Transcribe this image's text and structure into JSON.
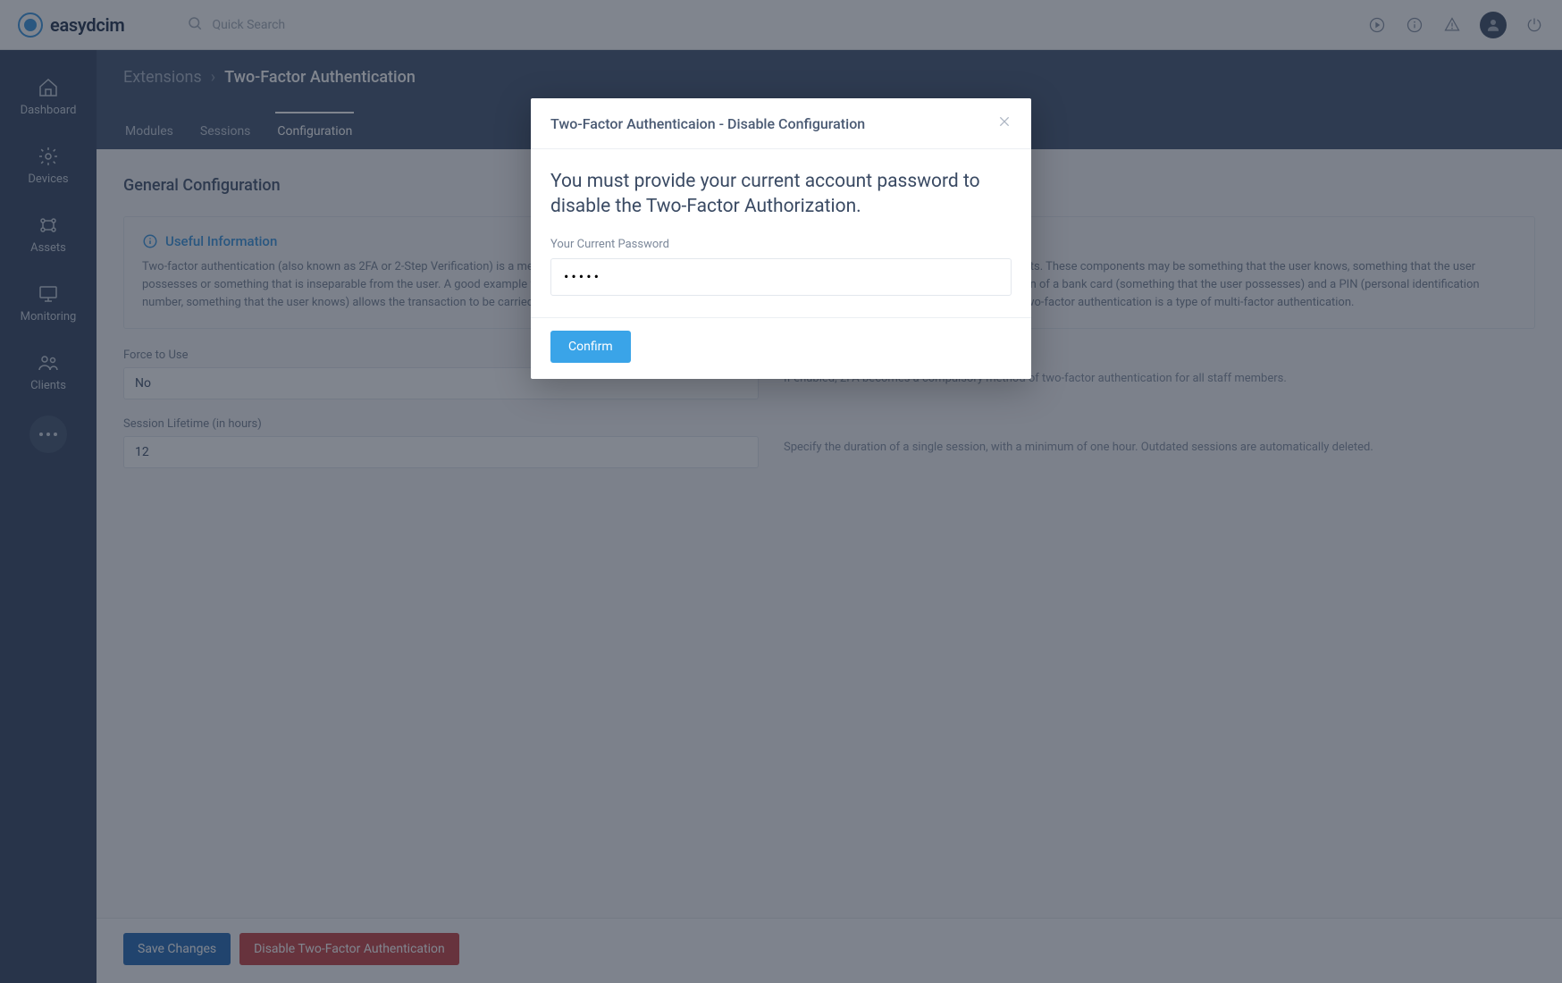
{
  "brand": {
    "name": "easydcim"
  },
  "search": {
    "placeholder": "Quick Search"
  },
  "sidebar": {
    "items": [
      {
        "label": "Dashboard"
      },
      {
        "label": "Devices"
      },
      {
        "label": "Assets"
      },
      {
        "label": "Monitoring"
      },
      {
        "label": "Clients"
      }
    ]
  },
  "breadcrumb": {
    "parent": "Extensions",
    "current": "Two-Factor Authentication"
  },
  "tabs": [
    {
      "label": "Modules"
    },
    {
      "label": "Sessions"
    },
    {
      "label": "Configuration"
    }
  ],
  "section": {
    "title": "General Configuration"
  },
  "info": {
    "heading": "Useful Information",
    "text": "Two-factor authentication (also known as 2FA or 2-Step Verification) is a method of confirming a user's claimed identity by utilizing a combination of two different components. These components may be something that the user knows, something that the user possesses or something that is inseparable from the user. A good example from everyday life is the withdrawing of money from a cash machine. Only the correct combination of a bank card (something that the user possesses) and a PIN (personal identification number, something that the user knows) allows the transaction to be carried out. 2FA is ineffective against modern threats, like ATM skimming, phishing, and malware etc. Two-factor authentication is a type of multi-factor authentication."
  },
  "fields": {
    "force": {
      "label": "Force to Use",
      "value": "No",
      "help": "If enabled, 2FA becomes a compulsory method of two-factor authentication for all staff members."
    },
    "session": {
      "label": "Session Lifetime (in hours)",
      "value": "12",
      "help": "Specify the duration of a single session, with a minimum of one hour. Outdated sessions are automatically deleted."
    }
  },
  "footer": {
    "save": "Save Changes",
    "disable": "Disable Two-Factor Authentication"
  },
  "modal": {
    "title": "Two-Factor Authenticaion - Disable Configuration",
    "message": "You must provide your current account password to disable the Two-Factor Authorization.",
    "passwordLabel": "Your Current Password",
    "passwordValue": "•••••",
    "confirm": "Confirm"
  }
}
